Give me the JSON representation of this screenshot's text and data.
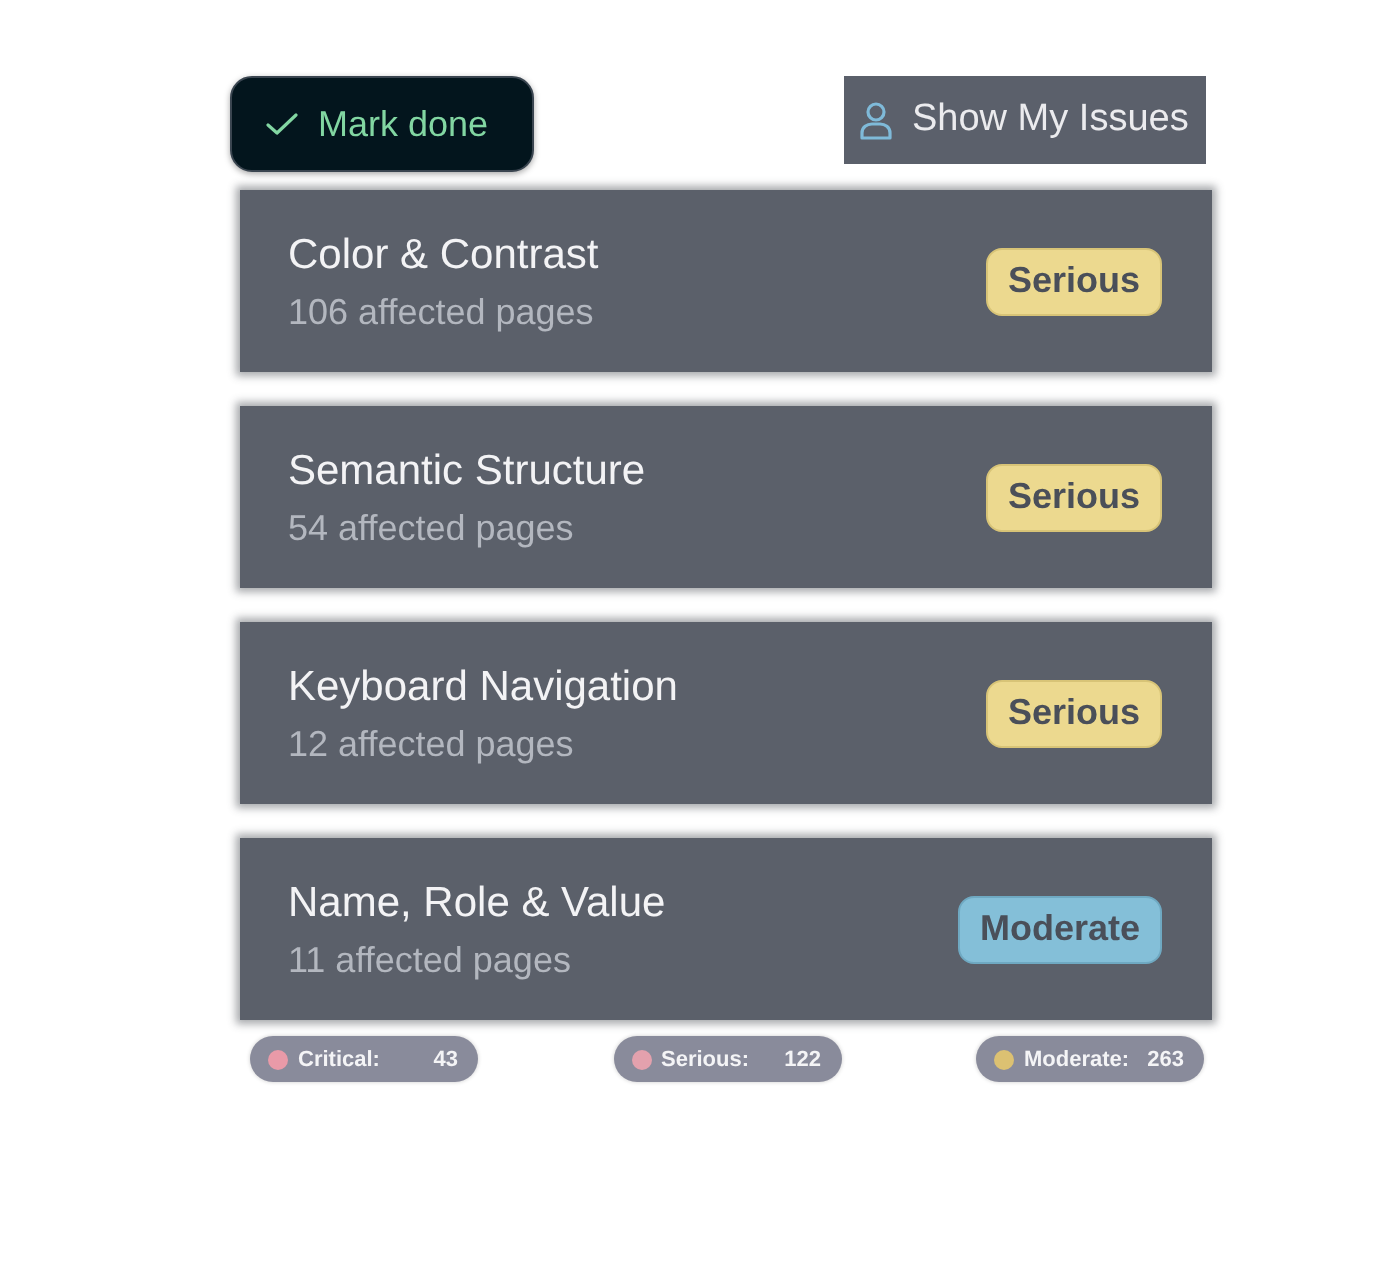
{
  "actions": {
    "mark_done": {
      "label": "Mark done"
    },
    "show_my_issues": {
      "label": "Show My Issues"
    }
  },
  "issues": [
    {
      "title": "Color & Contrast",
      "subtitle": "106 affected pages",
      "badge": "Serious",
      "kind": "serious"
    },
    {
      "title": "Semantic Structure",
      "subtitle": "54 affected pages",
      "badge": "Serious",
      "kind": "serious"
    },
    {
      "title": "Keyboard Navigation",
      "subtitle": "12 affected pages",
      "badge": "Serious",
      "kind": "serious"
    },
    {
      "title": "Name, Role & Value",
      "subtitle": "11 affected pages",
      "badge": "Moderate",
      "kind": "moderate"
    }
  ],
  "summary": [
    {
      "label": "Critical:",
      "count": "43",
      "color": "#e99aa8"
    },
    {
      "label": "Serious:",
      "count": "122",
      "color": "#e3a1ad"
    },
    {
      "label": "Moderate:",
      "count": "263",
      "color": "#dcc172"
    }
  ]
}
